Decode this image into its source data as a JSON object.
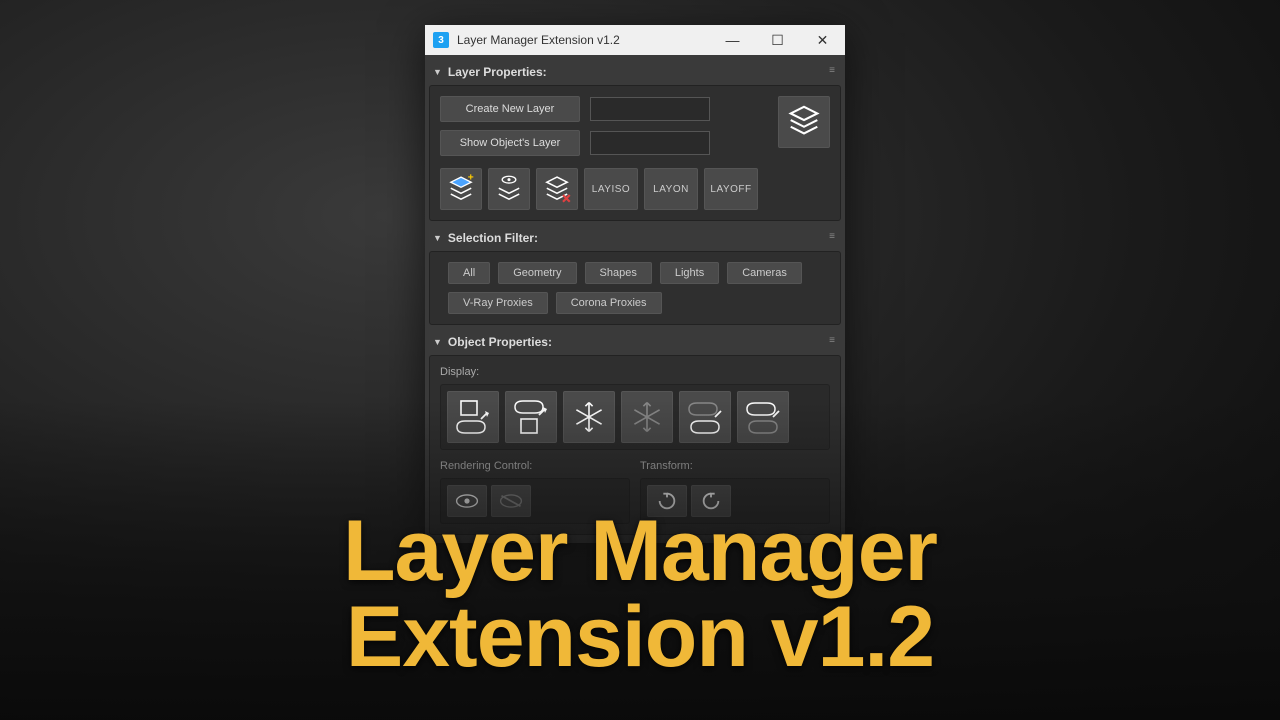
{
  "window": {
    "title": "Layer Manager Extension v1.2",
    "app_icon_char": "3"
  },
  "sections": {
    "layer_props": {
      "title": "Layer Properties:",
      "create_btn": "Create New Layer",
      "show_btn": "Show Object's Layer",
      "layiso": "LAYISO",
      "layon": "LAYON",
      "layoff": "LAYOFF"
    },
    "selection_filter": {
      "title": "Selection Filter:",
      "buttons": [
        "All",
        "Geometry",
        "Shapes",
        "Lights",
        "Cameras",
        "V-Ray Proxies",
        "Corona Proxies"
      ]
    },
    "object_props": {
      "title": "Object Properties:",
      "display_label": "Display:",
      "rendering_label": "Rendering Control:",
      "transform_label": "Transform:"
    }
  },
  "overlay": {
    "line1": "Layer Manager",
    "line2": "Extension v1.2"
  }
}
